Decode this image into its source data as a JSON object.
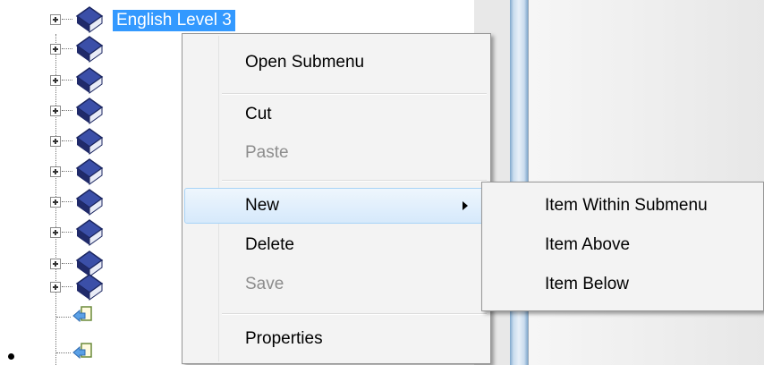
{
  "tree": {
    "selected_label": "English Level 3",
    "icons": {
      "book": "book-icon",
      "link": "shortcut-link-icon",
      "expander": "expand-plus-icon"
    }
  },
  "context_menu": {
    "items": [
      {
        "label": "Open Submenu",
        "enabled": true
      },
      {
        "label": "Cut",
        "enabled": true
      },
      {
        "label": "Paste",
        "enabled": false
      },
      {
        "label": "New",
        "enabled": true,
        "has_submenu": true,
        "highlighted": true
      },
      {
        "label": "Delete",
        "enabled": true
      },
      {
        "label": "Save",
        "enabled": false
      },
      {
        "label": "Properties",
        "enabled": true
      }
    ]
  },
  "submenu": {
    "items": [
      {
        "label": "Item Within Submenu"
      },
      {
        "label": "Item Above"
      },
      {
        "label": "Item Below"
      }
    ]
  },
  "colors": {
    "selection": "#3399ff",
    "menu_background": "#f3f3f3",
    "highlight_border": "#a9d4f7",
    "disabled_text": "#8d8d8d"
  }
}
